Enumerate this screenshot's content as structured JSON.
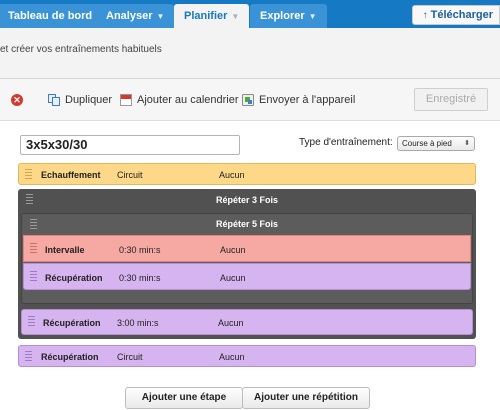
{
  "nav": {
    "tabs": [
      {
        "label": "Tableau de bord",
        "has_caret": false
      },
      {
        "label": "Analyser",
        "has_caret": true
      },
      {
        "label": "Planifier",
        "has_caret": true,
        "active": true
      },
      {
        "label": "Explorer",
        "has_caret": true
      }
    ],
    "download_label": "Télécharger",
    "download_icon": "arrow-up-icon"
  },
  "subtitle": "et créer vos entraînements habituels",
  "toolbar": {
    "delete_icon": "delete-icon",
    "duplicate_label": "Dupliquer",
    "calendar_label": "Ajouter au calendrier",
    "send_label": "Envoyer à l'appareil",
    "save_label": "Enregistré"
  },
  "workout": {
    "name": "3x5x30/30",
    "type_label": "Type d'entraînement:",
    "type_value": "Course à pied"
  },
  "steps": {
    "warmup": {
      "name": "Echauffement",
      "duration": "Circuit",
      "target": "Aucun"
    },
    "repeat_outer": {
      "label": "Répéter 3 Fois"
    },
    "repeat_inner": {
      "label": "Répéter 5 Fois"
    },
    "interval": {
      "name": "Intervalle",
      "duration": "0:30 min:s",
      "target": "Aucun"
    },
    "recovery_inner": {
      "name": "Récupération",
      "duration": "0:30 min:s",
      "target": "Aucun"
    },
    "recovery_outer": {
      "name": "Récupération",
      "duration": "3:00 min:s",
      "target": "Aucun"
    },
    "recovery_last": {
      "name": "Récupération",
      "duration": "Circuit",
      "target": "Aucun"
    }
  },
  "actions": {
    "add_step": "Ajouter une étape",
    "add_repeat": "Ajouter une répétition"
  },
  "colors": {
    "nav_bg": "#1679c4",
    "warmup": "#fcd888",
    "interval": "#f6a8a3",
    "recovery": "#d5b4ef",
    "repeat": "#515151"
  }
}
